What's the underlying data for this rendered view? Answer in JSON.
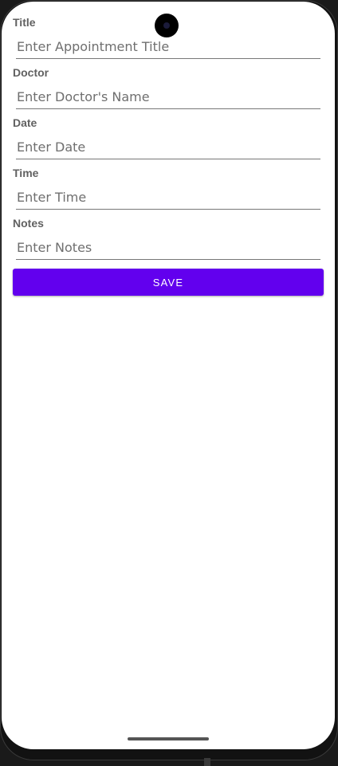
{
  "form": {
    "fields": [
      {
        "label": "Title",
        "placeholder": "Enter Appointment Title",
        "value": ""
      },
      {
        "label": "Doctor",
        "placeholder": "Enter Doctor's Name",
        "value": ""
      },
      {
        "label": "Date",
        "placeholder": "Enter Date",
        "value": ""
      },
      {
        "label": "Time",
        "placeholder": "Enter Time",
        "value": ""
      },
      {
        "label": "Notes",
        "placeholder": "Enter Notes",
        "value": ""
      }
    ],
    "save_label": "SAVE"
  },
  "colors": {
    "accent": "#6200ee",
    "label": "#616161",
    "background": "#ffffff"
  }
}
